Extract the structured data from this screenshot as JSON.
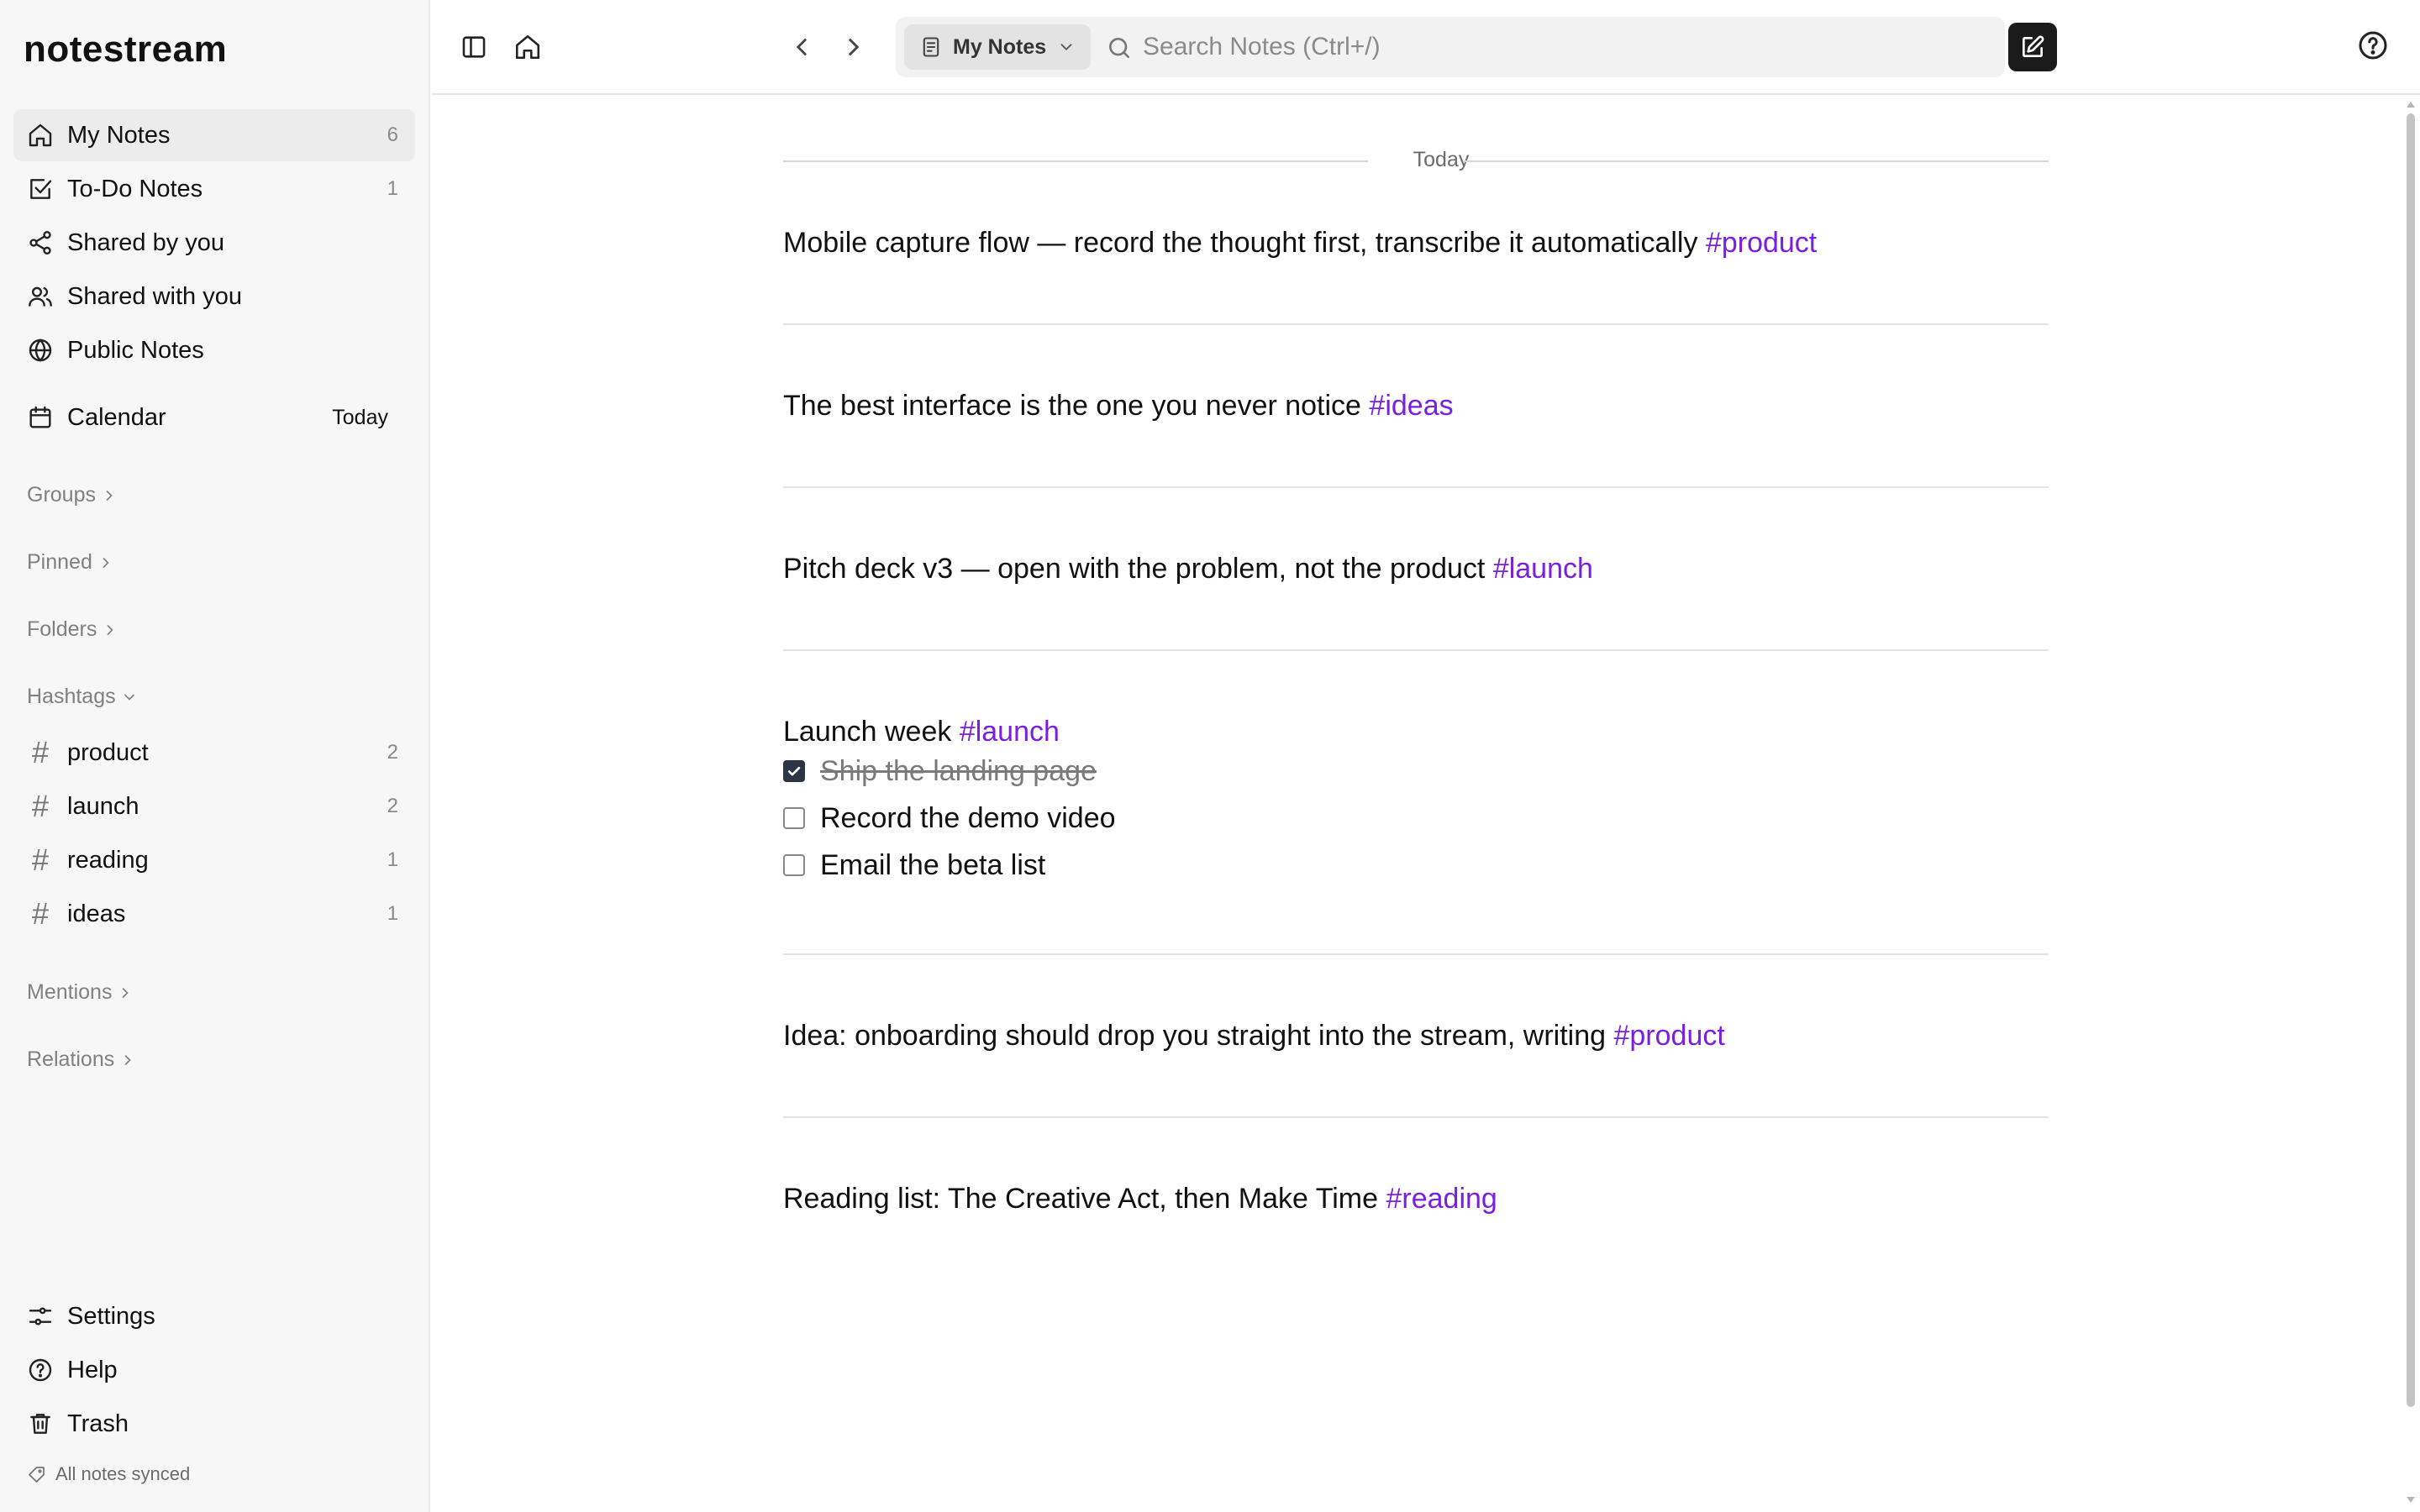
{
  "app": {
    "name": "notestream"
  },
  "sidebar": {
    "nav": [
      {
        "label": "My Notes",
        "count": "6",
        "icon": "home-icon"
      },
      {
        "label": "To-Do Notes",
        "count": "1",
        "icon": "checkbox-icon"
      },
      {
        "label": "Shared by you",
        "count": "",
        "icon": "share-icon"
      },
      {
        "label": "Shared with you",
        "count": "",
        "icon": "users-icon"
      },
      {
        "label": "Public Notes",
        "count": "",
        "icon": "globe-icon"
      }
    ],
    "calendar": {
      "label": "Calendar",
      "today_link": "Today",
      "icon": "calendar-icon"
    },
    "sections": {
      "groups": "Groups",
      "pinned": "Pinned",
      "folders": "Folders",
      "hashtags": "Hashtags",
      "mentions": "Mentions",
      "relations": "Relations"
    },
    "hashtags": [
      {
        "label": "product",
        "count": "2"
      },
      {
        "label": "launch",
        "count": "2"
      },
      {
        "label": "reading",
        "count": "1"
      },
      {
        "label": "ideas",
        "count": "1"
      }
    ],
    "bottom": [
      {
        "label": "Settings",
        "icon": "sliders-icon"
      },
      {
        "label": "Help",
        "icon": "help-circle-icon"
      },
      {
        "label": "Trash",
        "icon": "trash-icon"
      }
    ],
    "sync_status": "All notes synced"
  },
  "topbar": {
    "scope_label": "My Notes",
    "search_placeholder": "Search Notes (Ctrl+/)",
    "icons": [
      "sidebar-toggle-icon",
      "home-icon",
      "chevron-left-icon",
      "chevron-right-icon",
      "new-note-icon",
      "help-circle-icon"
    ]
  },
  "stream": {
    "day_label": "Today",
    "notes": [
      {
        "text": "Mobile capture flow — record the thought first, transcribe it automatically ",
        "tag": "#product"
      },
      {
        "text": "The best interface is the one you never notice ",
        "tag": "#ideas"
      },
      {
        "text": "Pitch deck v3 — open with the problem, not the product ",
        "tag": "#launch"
      },
      {
        "text": "Launch week ",
        "tag": "#launch",
        "todos": [
          {
            "text": "Ship the landing page",
            "done": true
          },
          {
            "text": "Record the demo video",
            "done": false
          },
          {
            "text": "Email the beta list",
            "done": false
          }
        ]
      },
      {
        "text": "Idea: onboarding should drop you straight into the stream, writing ",
        "tag": "#product"
      },
      {
        "text": "Reading list: The Creative Act, then Make Time ",
        "tag": "#reading"
      }
    ]
  },
  "colors": {
    "tag": "#7a1fe0",
    "sidebar_bg": "#f7f7f7",
    "active_item_bg": "#ececec",
    "checkbox_checked": "#2c3544",
    "new_note_button": "#1b1b1b"
  }
}
